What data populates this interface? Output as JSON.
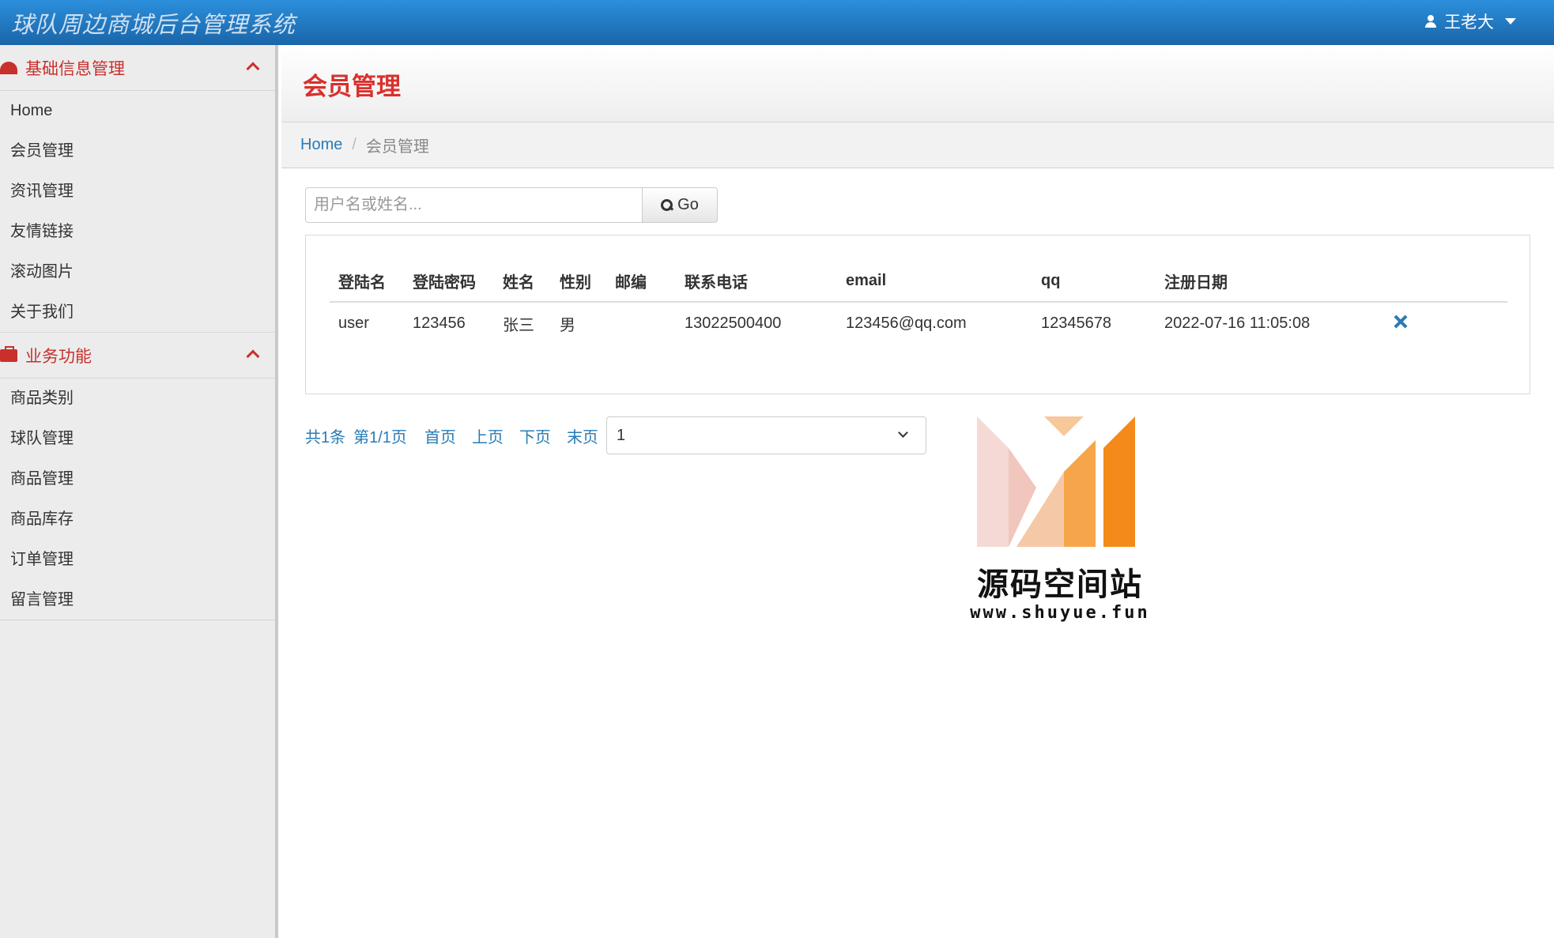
{
  "app": {
    "title": "球队周边商城后台管理系统",
    "user": "王老大"
  },
  "sidebar": {
    "sections": [
      {
        "title": "基础信息管理",
        "icon": "dashboard-icon",
        "items": [
          "Home",
          "会员管理",
          "资讯管理",
          "友情链接",
          "滚动图片",
          "关于我们"
        ]
      },
      {
        "title": "业务功能",
        "icon": "briefcase-icon",
        "items": [
          "商品类别",
          "球队管理",
          "商品管理",
          "商品库存",
          "订单管理",
          "留言管理"
        ]
      }
    ]
  },
  "page": {
    "title": "会员管理",
    "breadcrumb": {
      "home": "Home",
      "current": "会员管理"
    }
  },
  "search": {
    "placeholder": "用户名或姓名...",
    "value": "",
    "button_label": "Go"
  },
  "table": {
    "headers": [
      "登陆名",
      "登陆密码",
      "姓名",
      "性别",
      "邮编",
      "联系电话",
      "email",
      "qq",
      "注册日期",
      ""
    ],
    "rows": [
      {
        "login": "user",
        "password": "123456",
        "name": "张三",
        "gender": "男",
        "zip": "",
        "phone": "13022500400",
        "email": "123456@qq.com",
        "qq": "12345678",
        "reg_date": "2022-07-16 11:05:08"
      }
    ]
  },
  "pager": {
    "total": "共1条",
    "page_info": "第1/1页",
    "first": "首页",
    "prev": "上页",
    "next": "下页",
    "last": "末页",
    "selected_page": "1"
  },
  "watermark": {
    "text": "源码空间站",
    "url": "www.shuyue.fun"
  },
  "colors": {
    "topbar": "#1a65a8",
    "accent_red": "#d9302c",
    "link_blue": "#2a7bb5"
  }
}
